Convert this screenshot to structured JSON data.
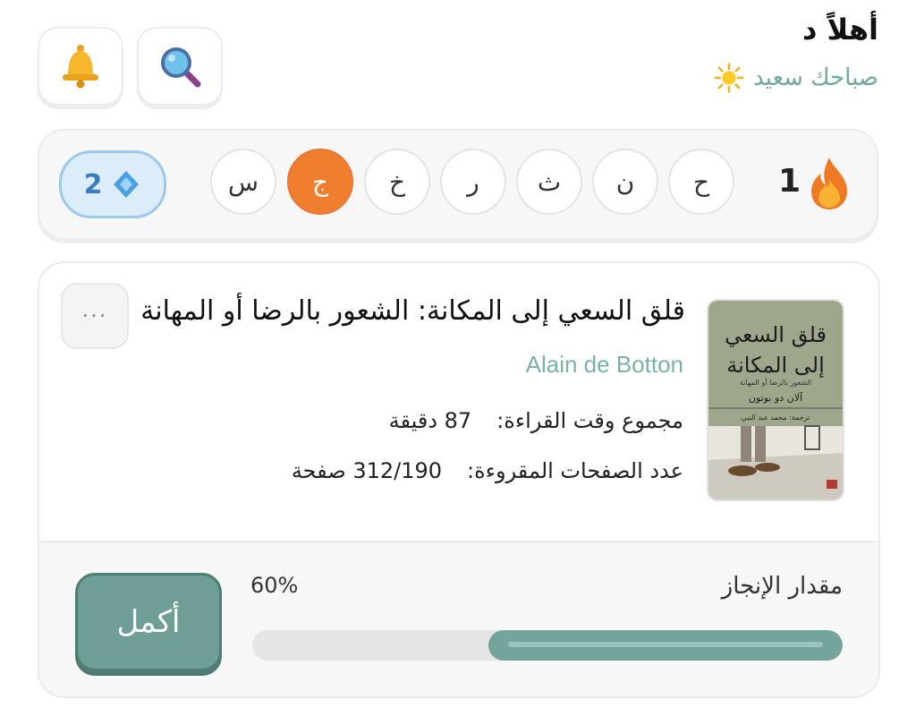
{
  "header": {
    "greeting": "أهلاً د",
    "subtitle": "صباحك سعيد",
    "sun_icon": "sun-icon"
  },
  "toolbar": {
    "search_icon": "search-icon",
    "bell_icon": "bell-icon"
  },
  "streak": {
    "count": "1",
    "flame_icon": "flame-icon",
    "gems": "2",
    "gem_icon": "gem-icon",
    "days": [
      {
        "label": "ح",
        "active": false
      },
      {
        "label": "ن",
        "active": false
      },
      {
        "label": "ث",
        "active": false
      },
      {
        "label": "ر",
        "active": false
      },
      {
        "label": "خ",
        "active": false
      },
      {
        "label": "ج",
        "active": true
      },
      {
        "label": "س",
        "active": false
      }
    ],
    "active_color": "#ef7f2f"
  },
  "book": {
    "title": "قلق السعي إلى المكانة: الشعور بالرضا أو المهانة",
    "author": "Alain de Botton",
    "more_label": "···",
    "reading_time_label": "مجموع وقت القراءة:",
    "reading_time_value": "87 دقيقة",
    "pages_label": "عدد الصفحات المقروءة:",
    "pages_value": "312/190 صفحة",
    "cover": {
      "title_line1": "قلق السعي",
      "title_line2": "إلى المكانة",
      "subtitle": "الشعور بالرضا أو المهانة",
      "author": "آلان دو بوتون",
      "translator": "ترجمة: محمد عبد النبي"
    }
  },
  "progress": {
    "label": "مقدار الإنجاز",
    "percent_text": "60%",
    "fraction": 0.6,
    "fill_color": "#74a59c"
  },
  "actions": {
    "continue_label": "أكمل"
  }
}
